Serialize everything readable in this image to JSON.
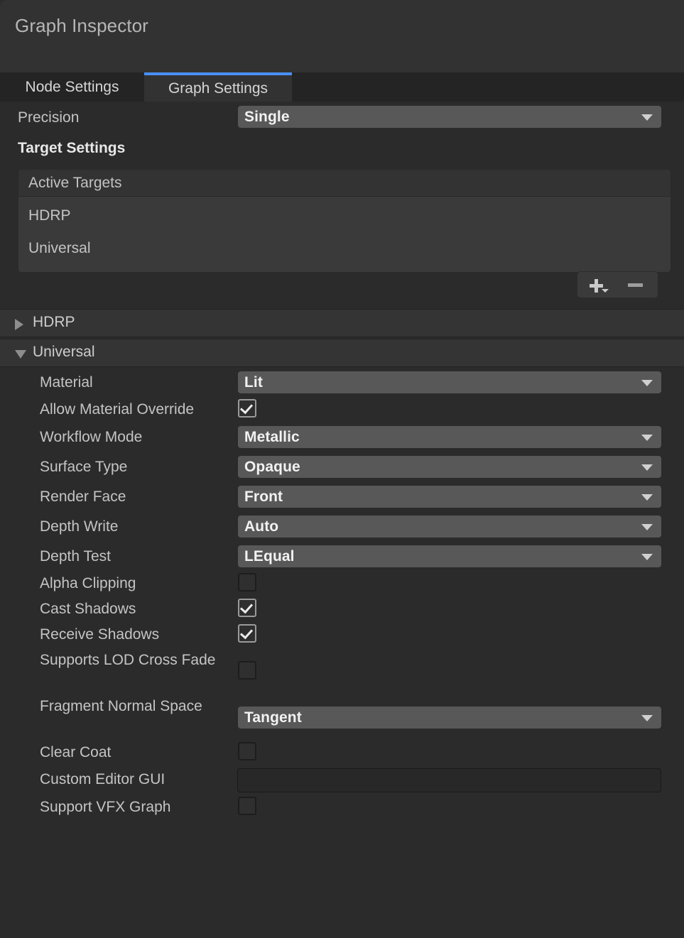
{
  "window": {
    "title": "Graph Inspector"
  },
  "tabs": [
    {
      "label": "Node Settings",
      "active": false
    },
    {
      "label": "Graph Settings",
      "active": true
    }
  ],
  "precision": {
    "label": "Precision",
    "value": "Single"
  },
  "target_settings": {
    "heading": "Target Settings",
    "list_header": "Active Targets",
    "items": [
      "HDRP",
      "Universal"
    ],
    "add_button": "add-target",
    "remove_button": "remove-target"
  },
  "foldouts": [
    {
      "label": "HDRP",
      "expanded": false
    },
    {
      "label": "Universal",
      "expanded": true
    }
  ],
  "universal_properties": [
    {
      "label": "Material",
      "type": "popup",
      "value": "Lit"
    },
    {
      "label": "Allow Material Override",
      "type": "checkbox",
      "value": true
    },
    {
      "label": "Workflow Mode",
      "type": "popup",
      "value": "Metallic"
    },
    {
      "label": "Surface Type",
      "type": "popup",
      "value": "Opaque"
    },
    {
      "label": "Render Face",
      "type": "popup",
      "value": "Front"
    },
    {
      "label": "Depth Write",
      "type": "popup",
      "value": "Auto"
    },
    {
      "label": "Depth Test",
      "type": "popup",
      "value": "LEqual"
    },
    {
      "label": "Alpha Clipping",
      "type": "checkbox",
      "value": false
    },
    {
      "label": "Cast Shadows",
      "type": "checkbox",
      "value": true
    },
    {
      "label": "Receive Shadows",
      "type": "checkbox",
      "value": true
    },
    {
      "label": "Supports LOD Cross Fade",
      "type": "checkbox",
      "value": false
    },
    {
      "label": "Fragment Normal Space",
      "type": "popup",
      "value": "Tangent"
    },
    {
      "label": "Clear Coat",
      "type": "checkbox",
      "value": false
    },
    {
      "label": "Custom Editor GUI",
      "type": "text",
      "value": ""
    },
    {
      "label": "Support VFX Graph",
      "type": "checkbox",
      "value": false
    }
  ],
  "colors": {
    "accent": "#4a8ff7",
    "panel": "#323232",
    "body": "#2b2b2b",
    "tabstrip": "#242424",
    "popup": "#585858"
  },
  "icons": {
    "dropdown": "chevron-down-icon",
    "foldout_closed": "triangle-right-icon",
    "foldout_open": "triangle-down-icon",
    "plus": "plus-icon",
    "minus": "minus-icon",
    "check": "check-icon"
  }
}
